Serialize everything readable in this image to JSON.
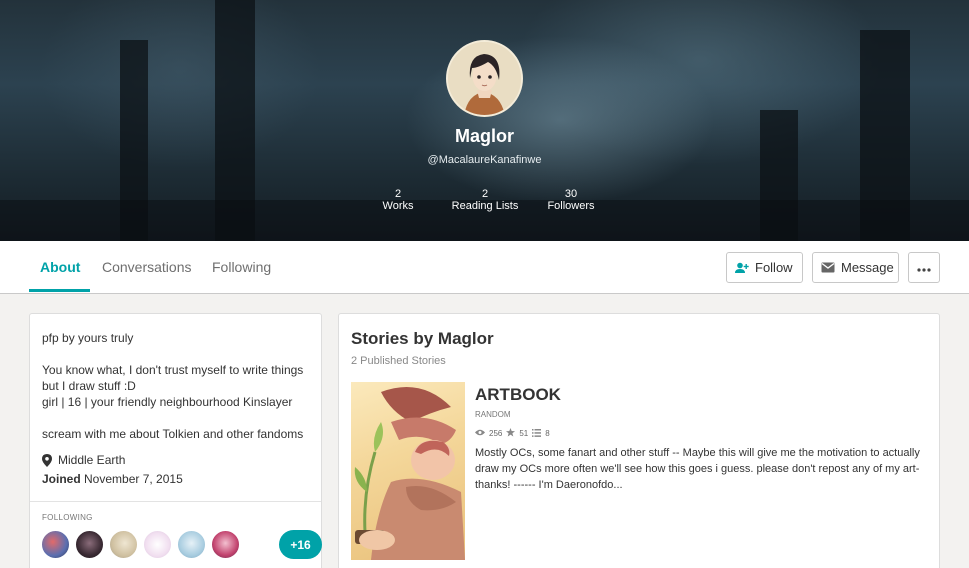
{
  "profile": {
    "name": "Maglor",
    "handle": "@MacalaureKanafinwe",
    "stats": [
      {
        "value": "2",
        "label": "Works"
      },
      {
        "value": "2",
        "label": "Reading Lists"
      },
      {
        "value": "30",
        "label": "Followers"
      }
    ]
  },
  "tabs": {
    "about": "About",
    "conversations": "Conversations",
    "following": "Following"
  },
  "actions": {
    "follow": "Follow",
    "message": "Message"
  },
  "about": {
    "line1": "pfp by yours truly",
    "line2": "You know what, I don't trust myself to write things",
    "line3": "but I draw stuff :D",
    "line4": "girl | 16 | your friendly neighbourhood Kinslayer",
    "line5": "scream with me about Tolkien and other fandoms",
    "location": "Middle Earth",
    "joined_label": "Joined",
    "joined_date": "November 7, 2015",
    "following_label": "FOLLOWING",
    "following_more": "+16"
  },
  "stories": {
    "title": "Stories by Maglor",
    "count": "2 Published Stories",
    "items": [
      {
        "title": "ARTBOOK",
        "genre": "RANDOM",
        "reads": "256",
        "votes": "51",
        "parts": "8",
        "description": "Mostly OCs, some fanart and other stuff -- Maybe this will give me the motivation to actually draw my OCs more often we'll see how this goes i guess. please don't repost any of my art- thanks! ------ I'm Daeronofdo..."
      }
    ]
  },
  "colors": {
    "accent": "#00a2a8"
  }
}
